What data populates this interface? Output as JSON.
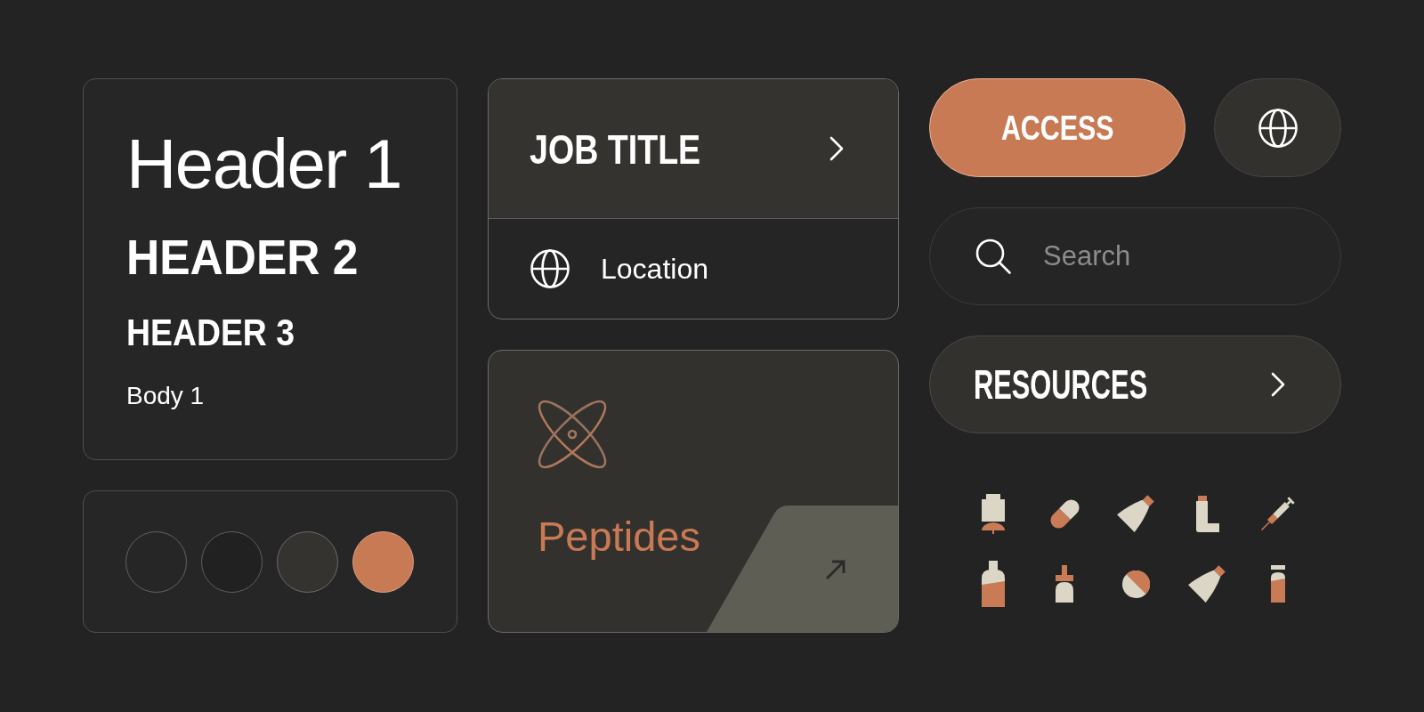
{
  "typography_card": {
    "header_1": "Header 1",
    "header_2": "HEADER 2",
    "header_3": "HEADER 3",
    "body_1": "Body 1"
  },
  "swatches": [
    {
      "color": "#262626"
    },
    {
      "color": "#212121"
    },
    {
      "color": "#35332f"
    },
    {
      "color": "#c87a55"
    }
  ],
  "job_card": {
    "title": "JOB TITLE",
    "location": "Location"
  },
  "category_card": {
    "title": "Peptides"
  },
  "access_button": {
    "label": "ACCESS"
  },
  "search": {
    "placeholder": "Search"
  },
  "resources_button": {
    "label": "RESOURCES"
  },
  "product_icons": [
    {
      "kind": "stand"
    },
    {
      "kind": "capsule"
    },
    {
      "kind": "tube"
    },
    {
      "kind": "inhaler"
    },
    {
      "kind": "syringe"
    },
    {
      "kind": "bottle"
    },
    {
      "kind": "dropper"
    },
    {
      "kind": "tablet"
    },
    {
      "kind": "tube"
    },
    {
      "kind": "vial"
    }
  ]
}
